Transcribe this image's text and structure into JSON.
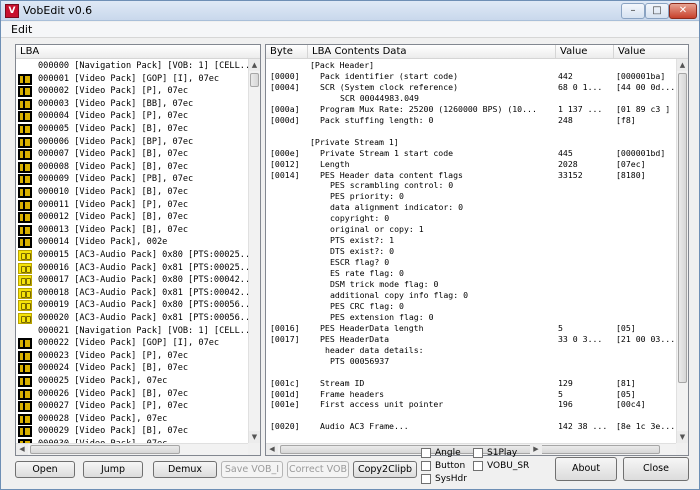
{
  "window": {
    "title": "VobEdit v0.6"
  },
  "menu": {
    "edit": "Edit"
  },
  "left_panel": {
    "header": "LBA",
    "rows": [
      {
        "icon": "none",
        "text": "000000 [Navigation Pack] [VOB: 1] [CELL..."
      },
      {
        "icon": "video",
        "text": "000001 [Video Pack] [GOP] [I], 07ec"
      },
      {
        "icon": "video",
        "text": "000002 [Video Pack] [P], 07ec"
      },
      {
        "icon": "video",
        "text": "000003 [Video Pack] [BB], 07ec"
      },
      {
        "icon": "video",
        "text": "000004 [Video Pack] [P], 07ec"
      },
      {
        "icon": "video",
        "text": "000005 [Video Pack] [B], 07ec"
      },
      {
        "icon": "video",
        "text": "000006 [Video Pack] [BP], 07ec"
      },
      {
        "icon": "video",
        "text": "000007 [Video Pack] [B], 07ec"
      },
      {
        "icon": "video",
        "text": "000008 [Video Pack] [B], 07ec"
      },
      {
        "icon": "video",
        "text": "000009 [Video Pack] [PB], 07ec"
      },
      {
        "icon": "video",
        "text": "000010 [Video Pack] [B], 07ec"
      },
      {
        "icon": "video",
        "text": "000011 [Video Pack] [P], 07ec"
      },
      {
        "icon": "video",
        "text": "000012 [Video Pack] [B], 07ec"
      },
      {
        "icon": "video",
        "text": "000013 [Video Pack] [B], 07ec"
      },
      {
        "icon": "video",
        "text": "000014 [Video Pack], 002e"
      },
      {
        "icon": "audio",
        "text": "000015 [AC3-Audio Pack] 0x80 [PTS:00025..."
      },
      {
        "icon": "audio",
        "text": "000016 [AC3-Audio Pack] 0x81 [PTS:00025..."
      },
      {
        "icon": "audio",
        "text": "000017 [AC3-Audio Pack] 0x80 [PTS:00042..."
      },
      {
        "icon": "audio",
        "text": "000018 [AC3-Audio Pack] 0x81 [PTS:00042..."
      },
      {
        "icon": "audio",
        "text": "000019 [AC3-Audio Pack] 0x80 [PTS:00056..."
      },
      {
        "icon": "audio",
        "text": "000020 [AC3-Audio Pack] 0x81 [PTS:00056..."
      },
      {
        "icon": "none",
        "text": "000021 [Navigation Pack] [VOB: 1] [CELL..."
      },
      {
        "icon": "video",
        "text": "000022 [Video Pack] [GOP] [I], 07ec"
      },
      {
        "icon": "video",
        "text": "000023 [Video Pack] [P], 07ec"
      },
      {
        "icon": "video",
        "text": "000024 [Video Pack] [B], 07ec"
      },
      {
        "icon": "video",
        "text": "000025 [Video Pack], 07ec"
      },
      {
        "icon": "video",
        "text": "000026 [Video Pack] [B], 07ec"
      },
      {
        "icon": "video",
        "text": "000027 [Video Pack] [P], 07ec"
      },
      {
        "icon": "video",
        "text": "000028 [Video Pack], 07ec"
      },
      {
        "icon": "video",
        "text": "000029 [Video Pack] [B], 07ec"
      },
      {
        "icon": "video",
        "text": "000030 [Video Pack], 07ec"
      }
    ]
  },
  "right_panel": {
    "headers": {
      "byte": "Byte",
      "desc": "LBA Contents Data",
      "value": "Value",
      "hex": "Value"
    },
    "rows": [
      {
        "byte": "",
        "desc": "[Pack Header]",
        "indent": 0,
        "value": "",
        "hex": ""
      },
      {
        "byte": "[0000]",
        "desc": "Pack identifier (start code)",
        "indent": 1,
        "value": "442",
        "hex": "[000001ba]"
      },
      {
        "byte": "[0004]",
        "desc": "SCR (System clock reference)",
        "indent": 1,
        "value": "68 0 1...",
        "hex": "[44 00 0d..."
      },
      {
        "byte": "",
        "desc": "SCR 00044983.049",
        "indent": 3,
        "value": "",
        "hex": ""
      },
      {
        "byte": "[000a]",
        "desc": "Program Mux Rate: 25200 (1260000 BPS) (10...",
        "indent": 1,
        "value": "1 137 ...",
        "hex": "[01 89 c3 ]"
      },
      {
        "byte": "[000d]",
        "desc": "Pack stuffing length: 0",
        "indent": 1,
        "value": "248",
        "hex": "[f8]"
      },
      {
        "byte": "",
        "desc": "",
        "indent": 0,
        "value": "",
        "hex": ""
      },
      {
        "byte": "",
        "desc": "[Private Stream 1]",
        "indent": 0,
        "value": "",
        "hex": ""
      },
      {
        "byte": "[000e]",
        "desc": "Private Stream 1 start code",
        "indent": 1,
        "value": "445",
        "hex": "[000001bd]"
      },
      {
        "byte": "[0012]",
        "desc": "Length",
        "indent": 1,
        "value": "2028",
        "hex": "[07ec]"
      },
      {
        "byte": "[0014]",
        "desc": "PES Header data content flags",
        "indent": 1,
        "value": "33152",
        "hex": "[8180]"
      },
      {
        "byte": "",
        "desc": "PES scrambling control: 0",
        "indent": 2,
        "value": "",
        "hex": ""
      },
      {
        "byte": "",
        "desc": "PES priority: 0",
        "indent": 2,
        "value": "",
        "hex": ""
      },
      {
        "byte": "",
        "desc": "data alignment indicator: 0",
        "indent": 2,
        "value": "",
        "hex": ""
      },
      {
        "byte": "",
        "desc": "copyright: 0",
        "indent": 2,
        "value": "",
        "hex": ""
      },
      {
        "byte": "",
        "desc": "original or copy: 1",
        "indent": 2,
        "value": "",
        "hex": ""
      },
      {
        "byte": "",
        "desc": "PTS exist?: 1",
        "indent": 2,
        "value": "",
        "hex": ""
      },
      {
        "byte": "",
        "desc": "DTS exist?: 0",
        "indent": 2,
        "value": "",
        "hex": ""
      },
      {
        "byte": "",
        "desc": "ESCR flag? 0",
        "indent": 2,
        "value": "",
        "hex": ""
      },
      {
        "byte": "",
        "desc": "ES rate flag: 0",
        "indent": 2,
        "value": "",
        "hex": ""
      },
      {
        "byte": "",
        "desc": "DSM trick mode flag: 0",
        "indent": 2,
        "value": "",
        "hex": ""
      },
      {
        "byte": "",
        "desc": "additional copy info flag: 0",
        "indent": 2,
        "value": "",
        "hex": ""
      },
      {
        "byte": "",
        "desc": "PES CRC flag: 0",
        "indent": 2,
        "value": "",
        "hex": ""
      },
      {
        "byte": "",
        "desc": "PES extension flag: 0",
        "indent": 2,
        "value": "",
        "hex": ""
      },
      {
        "byte": "[0016]",
        "desc": "PES HeaderData length",
        "indent": 1,
        "value": "5",
        "hex": "[05]"
      },
      {
        "byte": "[0017]",
        "desc": "PES HeaderData",
        "indent": 1,
        "value": "33 0 3...",
        "hex": "[21 00 03..."
      },
      {
        "byte": "",
        "desc": "header data details:",
        "indent": 1.5,
        "value": "",
        "hex": ""
      },
      {
        "byte": "",
        "desc": "PTS 00056937",
        "indent": 2,
        "value": "",
        "hex": ""
      },
      {
        "byte": "",
        "desc": "",
        "indent": 0,
        "value": "",
        "hex": ""
      },
      {
        "byte": "[001c]",
        "desc": "Stream ID",
        "indent": 1,
        "value": "129",
        "hex": "[81]"
      },
      {
        "byte": "[001d]",
        "desc": "Frame headers",
        "indent": 1,
        "value": "5",
        "hex": "[05]"
      },
      {
        "byte": "[001e]",
        "desc": "First access unit pointer",
        "indent": 1,
        "value": "196",
        "hex": "[00c4]"
      },
      {
        "byte": "",
        "desc": "",
        "indent": 0,
        "value": "",
        "hex": ""
      },
      {
        "byte": "[0020]",
        "desc": "Audio AC3 Frame...",
        "indent": 1,
        "value": "142 38 ...",
        "hex": "[8e 1c 3e..."
      }
    ]
  },
  "buttons": {
    "open": "Open",
    "jump": "Jump",
    "demux": "Demux",
    "save_vob": "Save VOB_I",
    "correct_vob": "Correct VOB",
    "copy2clipb": "Copy2Clipb",
    "about": "About",
    "close": "Close"
  },
  "checkboxes": {
    "angle": "Angle",
    "button": "Button",
    "sysHdr": "SysHdr",
    "s1play": "S1Play",
    "vobu_sr": "VOBU_SR"
  },
  "colors": {
    "audio_icon": "#f5e30a",
    "video_icon_bg": "#000000",
    "video_icon_fg": "#d9b000"
  }
}
